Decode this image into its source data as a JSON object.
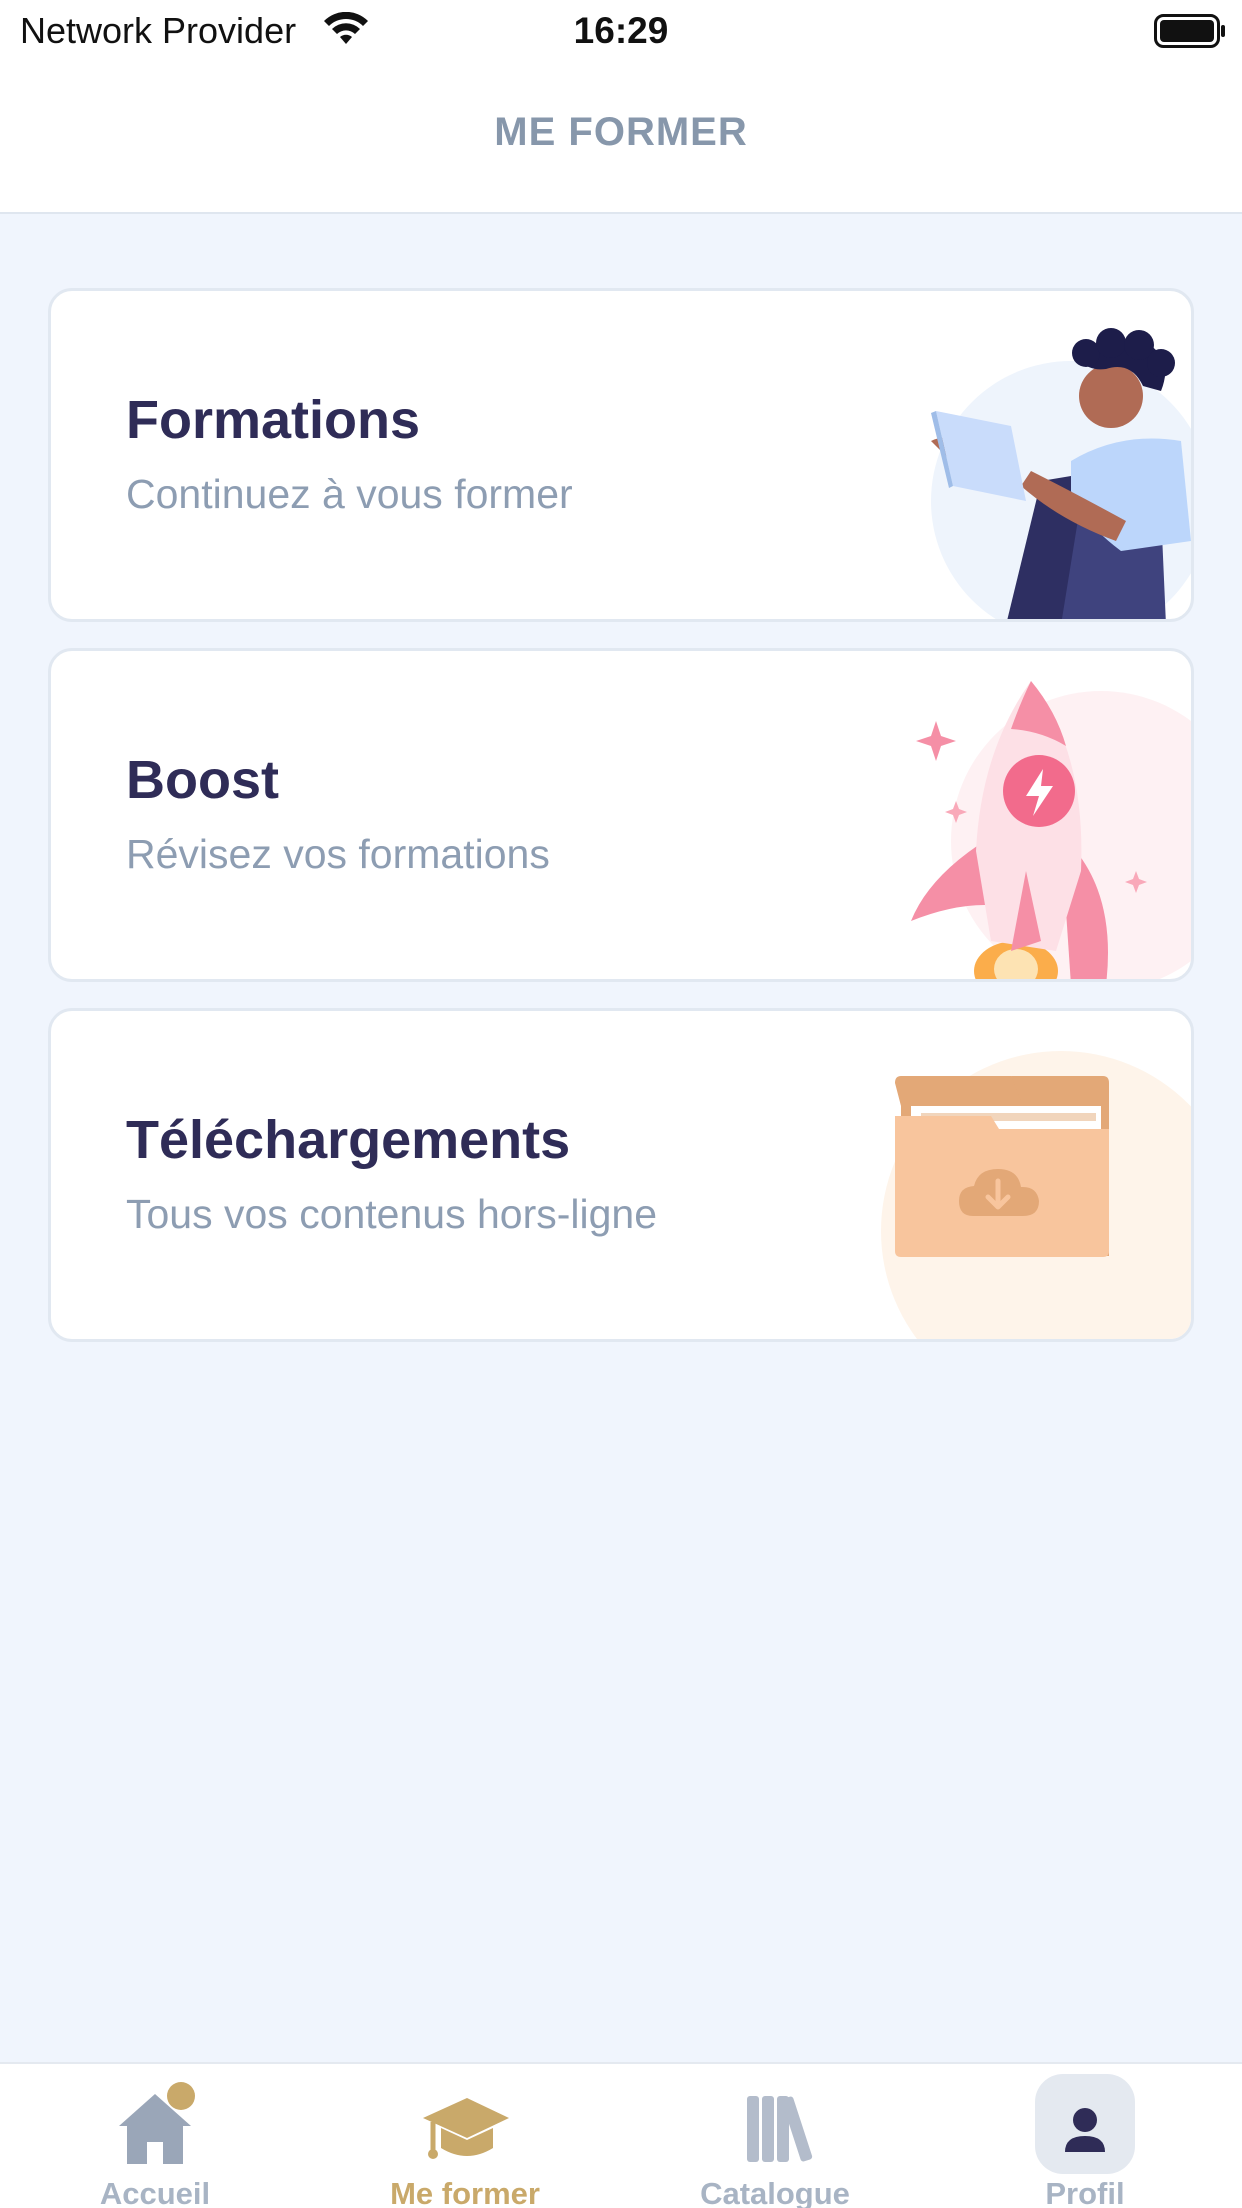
{
  "status_bar": {
    "carrier": "Network Provider",
    "time": "16:29"
  },
  "header": {
    "title": "ME FORMER"
  },
  "cards": [
    {
      "title": "Formations",
      "subtitle": "Continuez à vous former",
      "illustration": "person-reading-tablet"
    },
    {
      "title": "Boost",
      "subtitle": "Révisez vos formations",
      "illustration": "rocket"
    },
    {
      "title": "Téléchargements",
      "subtitle": "Tous vos contenus hors-ligne",
      "illustration": "cloud-download-folder"
    }
  ],
  "tab_bar": {
    "tabs": [
      {
        "label": "Accueil",
        "icon": "home-icon",
        "active": false
      },
      {
        "label": "Me former",
        "icon": "graduation-cap-icon",
        "active": true
      },
      {
        "label": "Catalogue",
        "icon": "books-icon",
        "active": false
      },
      {
        "label": "Profil",
        "icon": "user-icon",
        "active": false
      }
    ]
  },
  "colors": {
    "background": "#f0f5fd",
    "title_text": "#2f2c57",
    "subtitle_text": "#8d9db2",
    "header_text": "#8797ab",
    "active_tab": "#c9a96a",
    "inactive_tab": "#a8b4c4"
  }
}
